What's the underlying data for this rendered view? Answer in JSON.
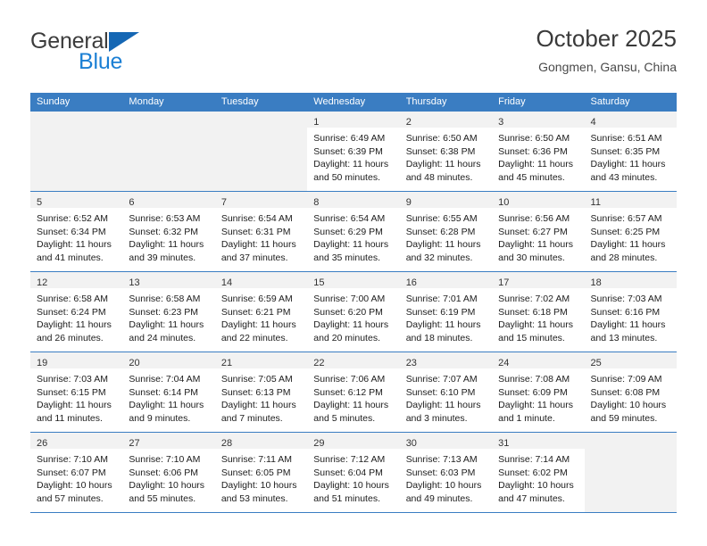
{
  "brand": {
    "name_part1": "General",
    "name_part2": "Blue",
    "triangle_color": "#1567b4",
    "blue_color": "#1b7fd4"
  },
  "header": {
    "title": "October 2025",
    "location": "Gongmen, Gansu, China"
  },
  "theme": {
    "header_row_bg": "#3a7dc2",
    "header_row_text": "#ffffff",
    "empty_cell_bg": "#f2f2f2",
    "daynum_band_bg": "#f2f2f2",
    "grid_line": "#3a7dc2"
  },
  "weekdays": [
    "Sunday",
    "Monday",
    "Tuesday",
    "Wednesday",
    "Thursday",
    "Friday",
    "Saturday"
  ],
  "weeks": [
    [
      {
        "empty": true
      },
      {
        "empty": true
      },
      {
        "empty": true
      },
      {
        "day": "1",
        "sunrise": "Sunrise: 6:49 AM",
        "sunset": "Sunset: 6:39 PM",
        "daylight_line1": "Daylight: 11 hours",
        "daylight_line2": "and 50 minutes."
      },
      {
        "day": "2",
        "sunrise": "Sunrise: 6:50 AM",
        "sunset": "Sunset: 6:38 PM",
        "daylight_line1": "Daylight: 11 hours",
        "daylight_line2": "and 48 minutes."
      },
      {
        "day": "3",
        "sunrise": "Sunrise: 6:50 AM",
        "sunset": "Sunset: 6:36 PM",
        "daylight_line1": "Daylight: 11 hours",
        "daylight_line2": "and 45 minutes."
      },
      {
        "day": "4",
        "sunrise": "Sunrise: 6:51 AM",
        "sunset": "Sunset: 6:35 PM",
        "daylight_line1": "Daylight: 11 hours",
        "daylight_line2": "and 43 minutes."
      }
    ],
    [
      {
        "day": "5",
        "sunrise": "Sunrise: 6:52 AM",
        "sunset": "Sunset: 6:34 PM",
        "daylight_line1": "Daylight: 11 hours",
        "daylight_line2": "and 41 minutes."
      },
      {
        "day": "6",
        "sunrise": "Sunrise: 6:53 AM",
        "sunset": "Sunset: 6:32 PM",
        "daylight_line1": "Daylight: 11 hours",
        "daylight_line2": "and 39 minutes."
      },
      {
        "day": "7",
        "sunrise": "Sunrise: 6:54 AM",
        "sunset": "Sunset: 6:31 PM",
        "daylight_line1": "Daylight: 11 hours",
        "daylight_line2": "and 37 minutes."
      },
      {
        "day": "8",
        "sunrise": "Sunrise: 6:54 AM",
        "sunset": "Sunset: 6:29 PM",
        "daylight_line1": "Daylight: 11 hours",
        "daylight_line2": "and 35 minutes."
      },
      {
        "day": "9",
        "sunrise": "Sunrise: 6:55 AM",
        "sunset": "Sunset: 6:28 PM",
        "daylight_line1": "Daylight: 11 hours",
        "daylight_line2": "and 32 minutes."
      },
      {
        "day": "10",
        "sunrise": "Sunrise: 6:56 AM",
        "sunset": "Sunset: 6:27 PM",
        "daylight_line1": "Daylight: 11 hours",
        "daylight_line2": "and 30 minutes."
      },
      {
        "day": "11",
        "sunrise": "Sunrise: 6:57 AM",
        "sunset": "Sunset: 6:25 PM",
        "daylight_line1": "Daylight: 11 hours",
        "daylight_line2": "and 28 minutes."
      }
    ],
    [
      {
        "day": "12",
        "sunrise": "Sunrise: 6:58 AM",
        "sunset": "Sunset: 6:24 PM",
        "daylight_line1": "Daylight: 11 hours",
        "daylight_line2": "and 26 minutes."
      },
      {
        "day": "13",
        "sunrise": "Sunrise: 6:58 AM",
        "sunset": "Sunset: 6:23 PM",
        "daylight_line1": "Daylight: 11 hours",
        "daylight_line2": "and 24 minutes."
      },
      {
        "day": "14",
        "sunrise": "Sunrise: 6:59 AM",
        "sunset": "Sunset: 6:21 PM",
        "daylight_line1": "Daylight: 11 hours",
        "daylight_line2": "and 22 minutes."
      },
      {
        "day": "15",
        "sunrise": "Sunrise: 7:00 AM",
        "sunset": "Sunset: 6:20 PM",
        "daylight_line1": "Daylight: 11 hours",
        "daylight_line2": "and 20 minutes."
      },
      {
        "day": "16",
        "sunrise": "Sunrise: 7:01 AM",
        "sunset": "Sunset: 6:19 PM",
        "daylight_line1": "Daylight: 11 hours",
        "daylight_line2": "and 18 minutes."
      },
      {
        "day": "17",
        "sunrise": "Sunrise: 7:02 AM",
        "sunset": "Sunset: 6:18 PM",
        "daylight_line1": "Daylight: 11 hours",
        "daylight_line2": "and 15 minutes."
      },
      {
        "day": "18",
        "sunrise": "Sunrise: 7:03 AM",
        "sunset": "Sunset: 6:16 PM",
        "daylight_line1": "Daylight: 11 hours",
        "daylight_line2": "and 13 minutes."
      }
    ],
    [
      {
        "day": "19",
        "sunrise": "Sunrise: 7:03 AM",
        "sunset": "Sunset: 6:15 PM",
        "daylight_line1": "Daylight: 11 hours",
        "daylight_line2": "and 11 minutes."
      },
      {
        "day": "20",
        "sunrise": "Sunrise: 7:04 AM",
        "sunset": "Sunset: 6:14 PM",
        "daylight_line1": "Daylight: 11 hours",
        "daylight_line2": "and 9 minutes."
      },
      {
        "day": "21",
        "sunrise": "Sunrise: 7:05 AM",
        "sunset": "Sunset: 6:13 PM",
        "daylight_line1": "Daylight: 11 hours",
        "daylight_line2": "and 7 minutes."
      },
      {
        "day": "22",
        "sunrise": "Sunrise: 7:06 AM",
        "sunset": "Sunset: 6:12 PM",
        "daylight_line1": "Daylight: 11 hours",
        "daylight_line2": "and 5 minutes."
      },
      {
        "day": "23",
        "sunrise": "Sunrise: 7:07 AM",
        "sunset": "Sunset: 6:10 PM",
        "daylight_line1": "Daylight: 11 hours",
        "daylight_line2": "and 3 minutes."
      },
      {
        "day": "24",
        "sunrise": "Sunrise: 7:08 AM",
        "sunset": "Sunset: 6:09 PM",
        "daylight_line1": "Daylight: 11 hours",
        "daylight_line2": "and 1 minute."
      },
      {
        "day": "25",
        "sunrise": "Sunrise: 7:09 AM",
        "sunset": "Sunset: 6:08 PM",
        "daylight_line1": "Daylight: 10 hours",
        "daylight_line2": "and 59 minutes."
      }
    ],
    [
      {
        "day": "26",
        "sunrise": "Sunrise: 7:10 AM",
        "sunset": "Sunset: 6:07 PM",
        "daylight_line1": "Daylight: 10 hours",
        "daylight_line2": "and 57 minutes."
      },
      {
        "day": "27",
        "sunrise": "Sunrise: 7:10 AM",
        "sunset": "Sunset: 6:06 PM",
        "daylight_line1": "Daylight: 10 hours",
        "daylight_line2": "and 55 minutes."
      },
      {
        "day": "28",
        "sunrise": "Sunrise: 7:11 AM",
        "sunset": "Sunset: 6:05 PM",
        "daylight_line1": "Daylight: 10 hours",
        "daylight_line2": "and 53 minutes."
      },
      {
        "day": "29",
        "sunrise": "Sunrise: 7:12 AM",
        "sunset": "Sunset: 6:04 PM",
        "daylight_line1": "Daylight: 10 hours",
        "daylight_line2": "and 51 minutes."
      },
      {
        "day": "30",
        "sunrise": "Sunrise: 7:13 AM",
        "sunset": "Sunset: 6:03 PM",
        "daylight_line1": "Daylight: 10 hours",
        "daylight_line2": "and 49 minutes."
      },
      {
        "day": "31",
        "sunrise": "Sunrise: 7:14 AM",
        "sunset": "Sunset: 6:02 PM",
        "daylight_line1": "Daylight: 10 hours",
        "daylight_line2": "and 47 minutes."
      },
      {
        "empty": true
      }
    ]
  ]
}
